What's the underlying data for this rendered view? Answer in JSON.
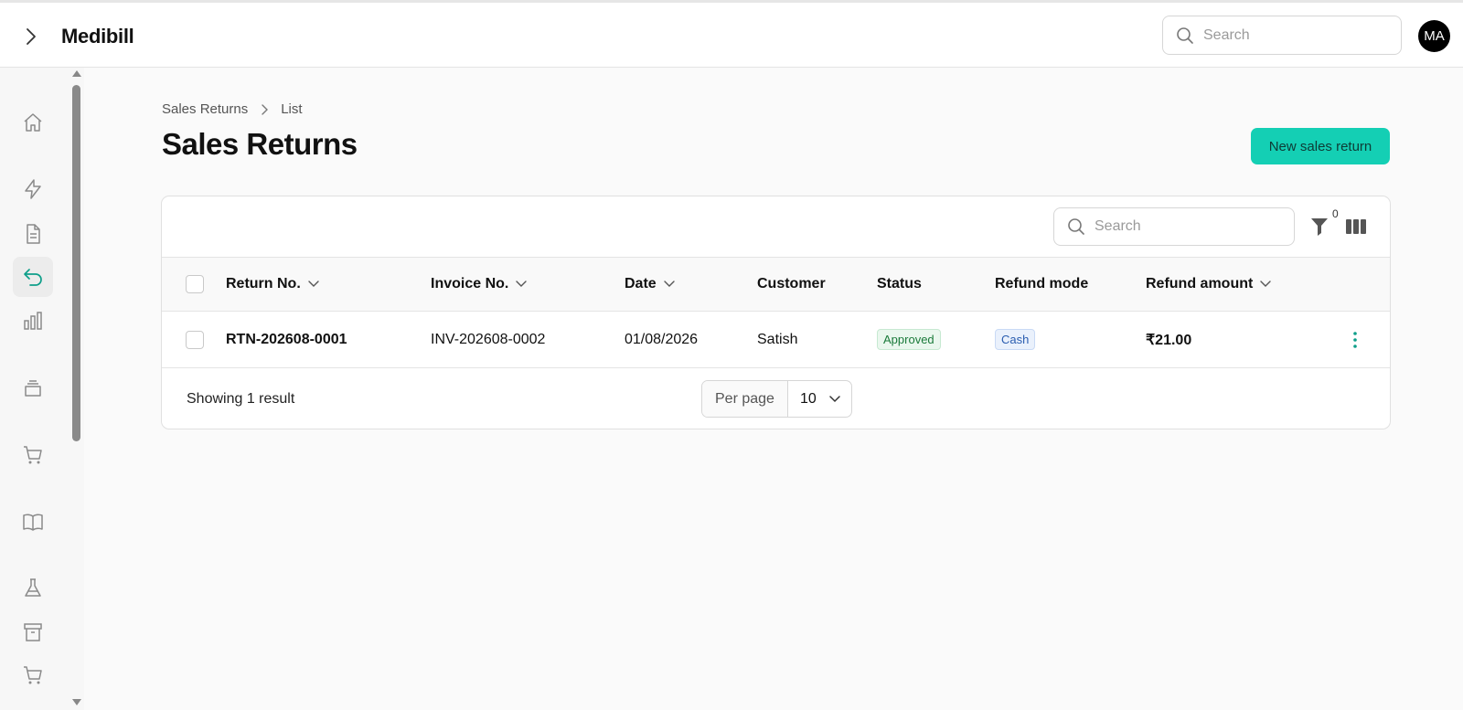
{
  "app": {
    "title": "Medibill",
    "search_placeholder": "Search",
    "user_initials": "MA"
  },
  "sidebar": {
    "items": [
      {
        "name": "home-icon",
        "active": false
      },
      {
        "name": "lightning-icon",
        "active": false
      },
      {
        "name": "document-icon",
        "active": false
      },
      {
        "name": "return-arrow-icon",
        "active": true
      },
      {
        "name": "bar-chart-icon",
        "active": false
      },
      {
        "name": "stack-icon",
        "active": false
      },
      {
        "name": "cart-icon",
        "active": false
      },
      {
        "name": "book-icon",
        "active": false
      },
      {
        "name": "flask-icon",
        "active": false
      },
      {
        "name": "archive-icon",
        "active": false
      },
      {
        "name": "cart-icon",
        "active": false
      }
    ]
  },
  "breadcrumb": {
    "parent": "Sales Returns",
    "current": "List"
  },
  "page": {
    "title": "Sales Returns",
    "new_button": "New sales return"
  },
  "table": {
    "search_placeholder": "Search",
    "filter_count": "0",
    "columns": [
      {
        "label": "Return No.",
        "sortable": true
      },
      {
        "label": "Invoice No.",
        "sortable": true
      },
      {
        "label": "Date",
        "sortable": true
      },
      {
        "label": "Customer",
        "sortable": false
      },
      {
        "label": "Status",
        "sortable": false
      },
      {
        "label": "Refund mode",
        "sortable": false
      },
      {
        "label": "Refund amount",
        "sortable": true
      }
    ],
    "rows": [
      {
        "return_no": "RTN-202608-0001",
        "invoice_no": "INV-202608-0002",
        "date": "01/08/2026",
        "customer": "Satish",
        "status": "Approved",
        "refund_mode": "Cash",
        "refund_amount": "₹21.00"
      }
    ],
    "footer": {
      "showing": "Showing 1 result",
      "per_page_label": "Per page",
      "per_page_value": "10"
    }
  },
  "colors": {
    "accent": "#14cfb4",
    "active_icon": "#0f9f8a",
    "status_approved": "#1b7a3a",
    "refund_mode_cash": "#2a5db0"
  }
}
